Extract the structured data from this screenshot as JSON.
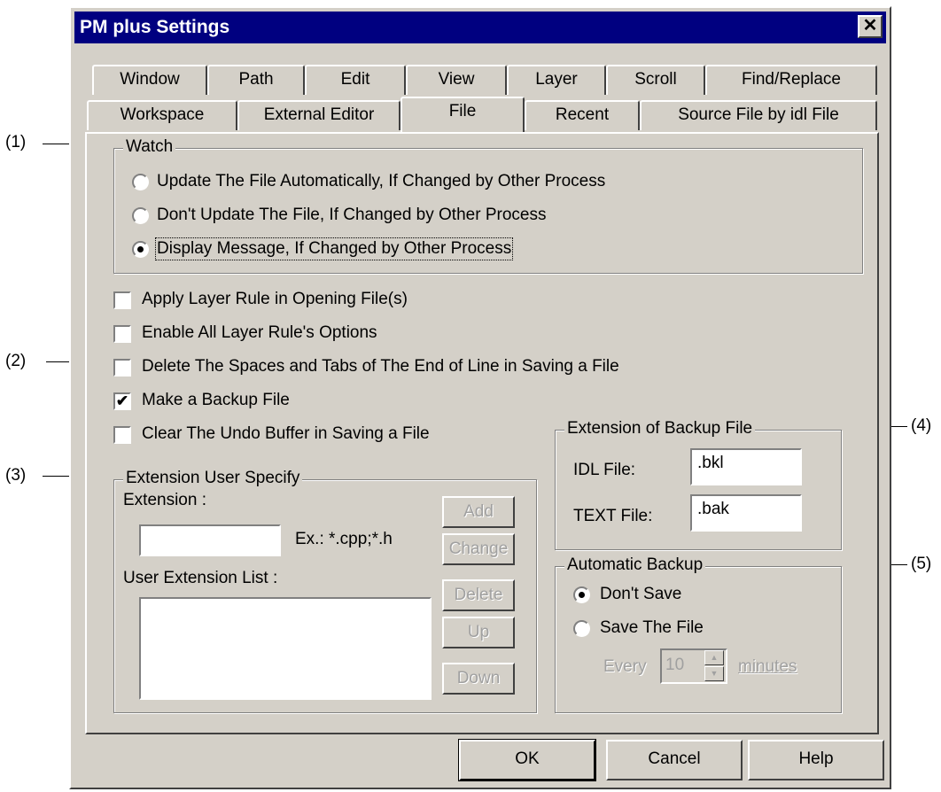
{
  "window": {
    "title": "PM plus Settings",
    "close_glyph": "✕"
  },
  "tabs_row1": [
    "Window",
    "Path",
    "Edit",
    "View",
    "Layer",
    "Scroll",
    "Find/Replace"
  ],
  "tabs_row2": [
    "Workspace",
    "External Editor",
    "File",
    "Recent",
    "Source File by idl File"
  ],
  "active_tab": "File",
  "watch": {
    "legend": "Watch",
    "options": [
      "Update The File Automatically, If Changed by Other Process",
      "Don't Update The File, If Changed by Other Process",
      "Display Message, If Changed by Other Process"
    ],
    "selected_index": 2
  },
  "checkboxes": [
    {
      "label": "Apply Layer Rule in Opening File(s)",
      "checked": false
    },
    {
      "label": "Enable All Layer Rule's Options",
      "checked": false
    },
    {
      "label": "Delete The Spaces and Tabs of The End of Line in Saving a File",
      "checked": false
    },
    {
      "label": "Make a Backup File",
      "checked": true
    },
    {
      "label": "Clear The Undo Buffer in Saving a File",
      "checked": false
    }
  ],
  "extension_user": {
    "legend": "Extension User Specify",
    "extension_label": "Extension :",
    "extension_value": "",
    "example": "Ex.: *.cpp;*.h",
    "list_label": "User Extension List :",
    "buttons": [
      "Add",
      "Change",
      "Delete",
      "Up",
      "Down"
    ]
  },
  "backup_ext": {
    "legend": "Extension of Backup File",
    "idl_label": "IDL File:",
    "idl_value": ".bkl",
    "text_label": "TEXT File:",
    "text_value": ".bak"
  },
  "auto_backup": {
    "legend": "Automatic Backup",
    "options": [
      "Don't Save",
      "Save The File"
    ],
    "selected_index": 0,
    "every_label": "Every",
    "minutes_value": "10",
    "minutes_label": "minutes"
  },
  "footer_buttons": {
    "ok": "OK",
    "cancel": "Cancel",
    "help": "Help"
  },
  "annotations": [
    "(1)",
    "(2)",
    "(3)",
    "(4)",
    "(5)"
  ],
  "colors": {
    "face": "#d4d0c8",
    "title_bar": "#000080",
    "disabled_text": "#a0a0a0"
  }
}
